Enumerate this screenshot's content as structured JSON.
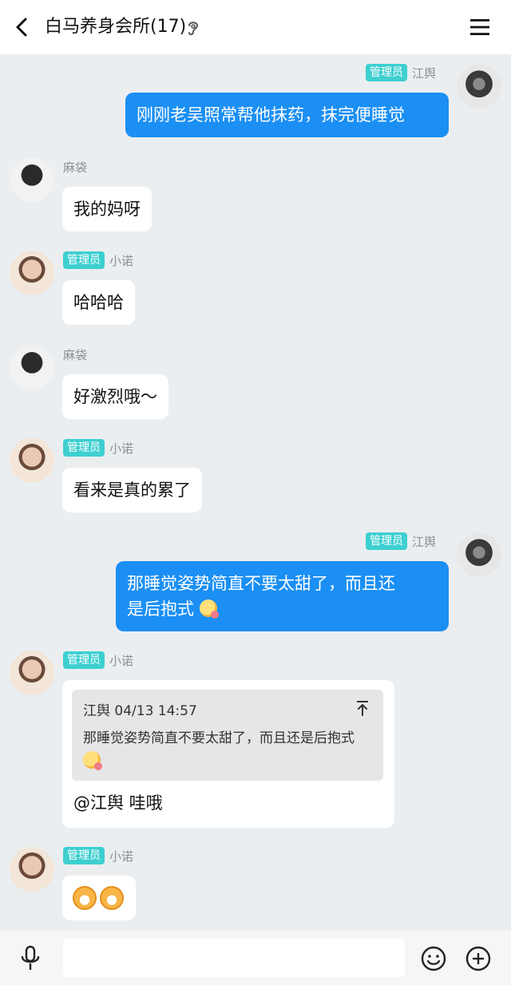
{
  "header": {
    "title": "白马养身会所(17)",
    "back_icon": "chevron-left-icon",
    "ear_icon": "ear-icon",
    "menu_icon": "menu-icon"
  },
  "messages": [
    {
      "side": "right",
      "badge": "管理员",
      "nick": "江舆",
      "text": "刚刚老吴照常帮他抹药，抹完便睡觉"
    },
    {
      "side": "left",
      "badge": "",
      "nick": "麻袋",
      "text": "我的妈呀"
    },
    {
      "side": "left",
      "badge": "管理员",
      "nick": "小诺",
      "text": "哈哈哈"
    },
    {
      "side": "left",
      "badge": "",
      "nick": "麻袋",
      "text": "好激烈哦～"
    },
    {
      "side": "left",
      "badge": "管理员",
      "nick": "小诺",
      "text": "看来是真的累了"
    },
    {
      "side": "right",
      "badge": "管理员",
      "nick": "江舆",
      "text_line1": "那睡觉姿势简直不要太甜了，而且还",
      "text_line2": "是后抱式"
    },
    {
      "side": "left",
      "badge": "管理员",
      "nick": "小诺",
      "quote": {
        "header": "江舆 04/13 14:57",
        "body": "那睡觉姿势简直不要太甜了，而且还是后抱式"
      },
      "reply": "@江舆 哇哦"
    },
    {
      "side": "left",
      "badge": "管理员",
      "nick": "小诺",
      "stickers": [
        "tiger-emoji",
        "tiger-emoji"
      ]
    }
  ],
  "footer": {
    "mic_icon": "microphone-icon",
    "input_value": "",
    "emoji_icon": "smiley-icon",
    "plus_icon": "plus-circle-icon"
  },
  "colors": {
    "background": "#ebeef0",
    "outgoing_bubble": "#1b8ff4",
    "admin_badge": "#3ecfd0"
  }
}
